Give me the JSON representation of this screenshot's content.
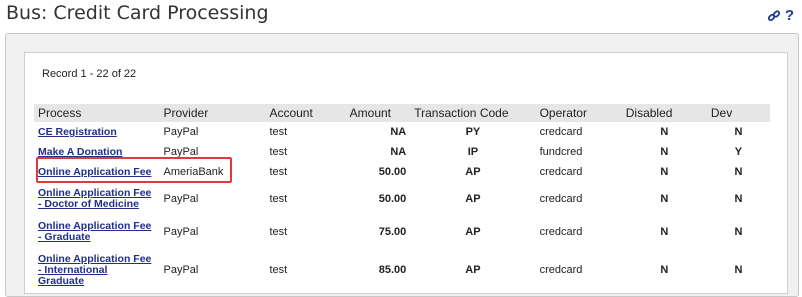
{
  "page": {
    "title": "Bus: Credit Card Processing",
    "help_label": "?"
  },
  "record": {
    "prefix": "Record 1 - 22 of 22"
  },
  "table": {
    "headers": [
      "Process",
      "Provider",
      "Account",
      "Amount",
      "Transaction Code",
      "Operator",
      "Disabled",
      "Dev"
    ],
    "rows": [
      {
        "process": "CE Registration",
        "provider": "PayPal",
        "account": "test",
        "amount": "NA",
        "code": "PY",
        "operator": "credcard",
        "disabled": "N",
        "dev": "N"
      },
      {
        "process": "Make A Donation",
        "provider": "PayPal",
        "account": "test",
        "amount": "NA",
        "code": "IP",
        "operator": "fundcred",
        "disabled": "N",
        "dev": "Y"
      },
      {
        "process": "Online Application Fee",
        "provider": "AmeriaBank",
        "account": "test",
        "amount": "50.00",
        "code": "AP",
        "operator": "credcard",
        "disabled": "N",
        "dev": "N"
      },
      {
        "process": "Online Application Fee - Doctor of Medicine",
        "provider": "PayPal",
        "account": "test",
        "amount": "50.00",
        "code": "AP",
        "operator": "credcard",
        "disabled": "N",
        "dev": "N"
      },
      {
        "process": "Online Application Fee - Graduate",
        "provider": "PayPal",
        "account": "test",
        "amount": "75.00",
        "code": "AP",
        "operator": "credcard",
        "disabled": "N",
        "dev": "N"
      },
      {
        "process": "Online Application Fee - International Graduate",
        "provider": "PayPal",
        "account": "test",
        "amount": "85.00",
        "code": "AP",
        "operator": "credcard",
        "disabled": "N",
        "dev": "N"
      }
    ]
  },
  "colors": {
    "link": "#1f2f8a",
    "highlight": "#e0393e",
    "header_bg": "#e6e6e6"
  },
  "icons": {
    "title_link": "link-icon",
    "title_help": "help-icon"
  }
}
